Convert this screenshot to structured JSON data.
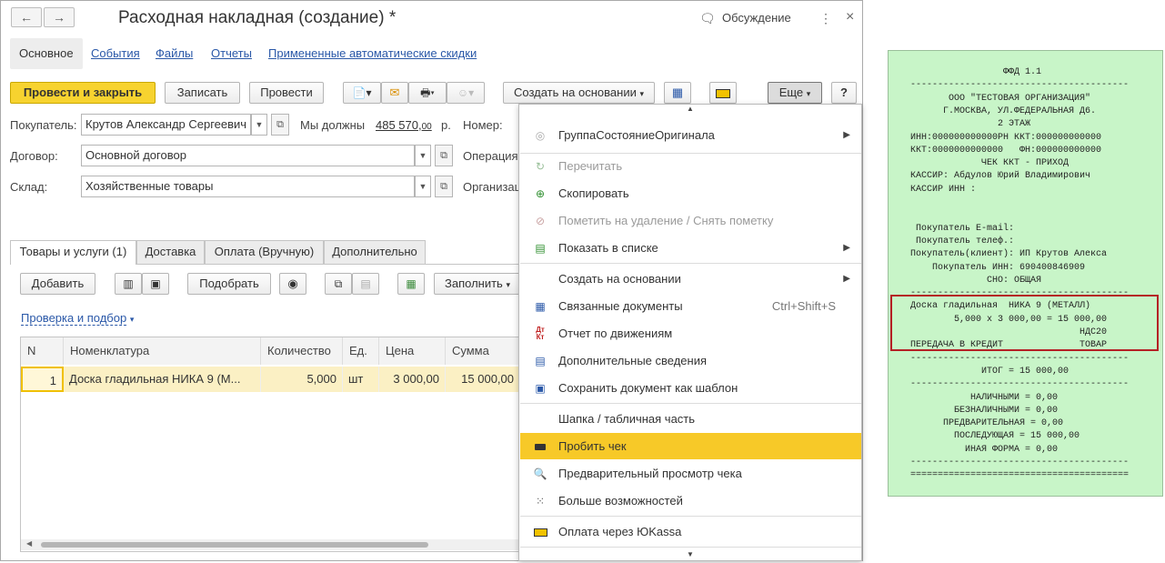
{
  "window": {
    "title": "Расходная накладная (создание) *",
    "discuss_label": "Обсуждение",
    "nav_back": "←",
    "nav_forward": "→",
    "menu_icon": "⋮",
    "close_icon": "×"
  },
  "main_tabs": [
    "Основное",
    "События",
    "Файлы",
    "Отчеты",
    "Примененные автоматические скидки"
  ],
  "toolbar": {
    "post_close": "Провести и закрыть",
    "save": "Записать",
    "post": "Провести",
    "create_based": "Создать на основании",
    "more": "Еще",
    "help": "?"
  },
  "form": {
    "buyer_label": "Покупатель:",
    "buyer_value": "Крутов Александр Сергеевич",
    "debt_label": "Мы должны",
    "debt_value": "485 570,",
    "debt_kop": "00",
    "debt_currency": "р.",
    "number_label": "Номер:",
    "contract_label": "Договор:",
    "contract_value": "Основной договор",
    "operation_label": "Операция",
    "warehouse_label": "Склад:",
    "warehouse_value": "Хозяйственные товары",
    "organization_label": "Организац"
  },
  "sub_tabs": [
    "Товары и услуги (1)",
    "Доставка",
    "Оплата (Вручную)",
    "Дополнительно"
  ],
  "table_toolbar": {
    "add": "Добавить",
    "pick": "Подобрать",
    "fill": "Заполнить",
    "check_link": "Проверка и подбор"
  },
  "table": {
    "headers": [
      "N",
      "Номенклатура",
      "Количество",
      "Ед.",
      "Цена",
      "Сумма"
    ],
    "rows": [
      [
        "1",
        "Доска гладильная  НИКА 9 (М...",
        "5,000",
        "шт",
        "3 000,00",
        "15 000,00"
      ]
    ]
  },
  "menu": {
    "items": [
      {
        "label": "ГруппаСостояниеОригинала",
        "shortcut": "",
        "submenu": true,
        "disabled": false,
        "icon": "status-circle-icon"
      },
      {
        "label": "Перечитать",
        "shortcut": "",
        "submenu": false,
        "disabled": true,
        "icon": "refresh-icon"
      },
      {
        "label": "Скопировать",
        "shortcut": "",
        "submenu": false,
        "disabled": false,
        "icon": "copy-icon"
      },
      {
        "label": "Пометить на удаление / Снять пометку",
        "shortcut": "",
        "submenu": false,
        "disabled": true,
        "icon": "delete-mark-icon"
      },
      {
        "label": "Показать в списке",
        "shortcut": "",
        "submenu": true,
        "disabled": false,
        "icon": "list-icon"
      },
      {
        "label": "Создать на основании",
        "shortcut": "",
        "submenu": true,
        "disabled": false,
        "icon": ""
      },
      {
        "label": "Связанные документы",
        "shortcut": "Ctrl+Shift+S",
        "submenu": false,
        "disabled": false,
        "icon": "linked-docs-icon"
      },
      {
        "label": "Отчет по движениям",
        "shortcut": "",
        "submenu": false,
        "disabled": false,
        "icon": "dt-kt-icon"
      },
      {
        "label": "Дополнительные сведения",
        "shortcut": "",
        "submenu": false,
        "disabled": false,
        "icon": "document-icon"
      },
      {
        "label": "Сохранить документ как шаблон",
        "shortcut": "",
        "submenu": false,
        "disabled": false,
        "icon": "template-icon"
      },
      {
        "label": "Шапка / табличная часть",
        "shortcut": "",
        "submenu": false,
        "disabled": false,
        "icon": ""
      },
      {
        "label": "Пробить чек",
        "shortcut": "",
        "submenu": false,
        "disabled": false,
        "icon": "cash-register-icon",
        "selected": true
      },
      {
        "label": "Предварительный просмотр чека",
        "shortcut": "",
        "submenu": false,
        "disabled": false,
        "icon": "preview-icon"
      },
      {
        "label": "Больше возможностей",
        "shortcut": "",
        "submenu": false,
        "disabled": false,
        "icon": "more-features-icon"
      },
      {
        "label": "Оплата через ЮKassa",
        "shortcut": "",
        "submenu": false,
        "disabled": false,
        "icon": "yookassa-icon"
      }
    ]
  },
  "receipt": {
    "lines": [
      "                 ФФД 1.1",
      "----------------------------------------",
      "       ООО \"ТЕСТОВАЯ ОРГАНИЗАЦИЯ\"",
      "      Г.МОСКВА, УЛ.ФЕДЕРАЛЬНАЯ Д6.",
      "                2 ЭТАЖ",
      "ИНН:000000000000РН ККТ:000000000000",
      "ККТ:0000000000000   ФН:000000000000",
      "             ЧЕК ККТ - ПРИХОД",
      "КАССИР: Абдулов Юрий Владимирович",
      "КАССИР ИНН :",
      "",
      "",
      " Покупатель E-mail:",
      " Покупатель телеф.:",
      "Покупатель(клиент): ИП Крутов Алекса",
      "    Покупатель ИНН: 690400846909",
      "              СНО: ОБЩАЯ",
      "----------------------------------------",
      "Доска гладильная  НИКА 9 (МЕТАЛЛ)",
      "        5,000 х 3 000,00 = 15 000,00",
      "                               НДС20",
      "ПЕРЕДАЧА В КРЕДИТ              ТОВАР",
      "----------------------------------------",
      "             ИТОГ = 15 000,00",
      "----------------------------------------",
      "           НАЛИЧНЫМИ = 0,00",
      "        БЕЗНАЛИЧНЫМИ = 0,00",
      "      ПРЕДВАРИТЕЛЬНАЯ = 0,00",
      "        ПОСЛЕДУЮЩАЯ = 15 000,00",
      "          ИНАЯ ФОРМА = 0,00",
      "----------------------------------------",
      "========================================"
    ]
  },
  "colors": {
    "accent_yellow": "#f7d32f",
    "menu_selected": "#f7c928",
    "receipt_bg": "#c8f5c8",
    "highlight_border": "#b52025",
    "link": "#2a58a8"
  }
}
